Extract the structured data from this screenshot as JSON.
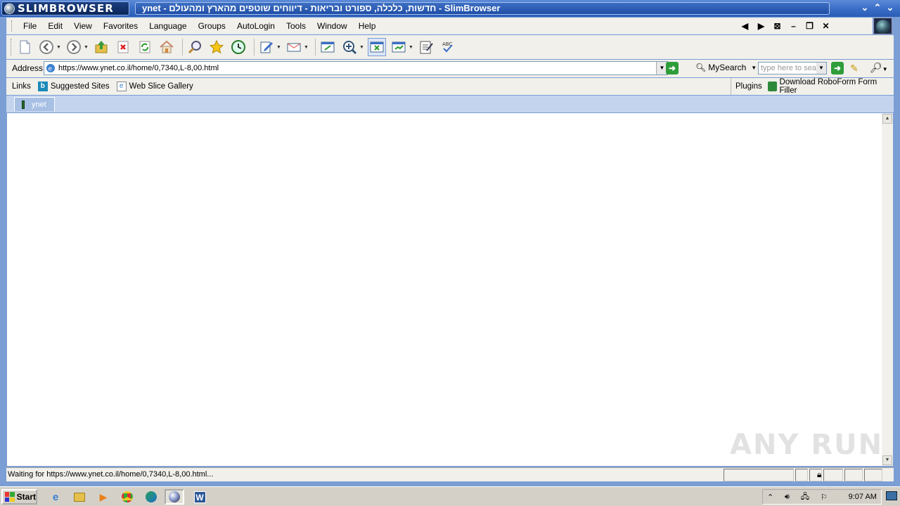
{
  "window": {
    "brand": "SLIMBROWSER",
    "title": "ynet - חדשות, כלכלה, ספורט ובריאות - דיווחים שוטפים מהארץ ומהעולם - SlimBrowser"
  },
  "menu": [
    "File",
    "Edit",
    "View",
    "Favorites",
    "Language",
    "Groups",
    "AutoLogin",
    "Tools",
    "Window",
    "Help"
  ],
  "address": {
    "label": "Address",
    "url": "https://www.ynet.co.il/home/0,7340,L-8,00.html"
  },
  "search": {
    "label": "MySearch",
    "placeholder": "type here to sea"
  },
  "links": {
    "label": "Links",
    "items": [
      "Suggested Sites",
      "Web Slice Gallery"
    ]
  },
  "plugins": {
    "label": "Plugins",
    "roboform": "Download RoboForm Form Filler"
  },
  "tabs": [
    {
      "label": "ynet"
    }
  ],
  "status": {
    "text": "Waiting for https://www.ynet.co.il/home/0,7340,L-8,00.html..."
  },
  "watermark": "ANY RUN",
  "taskbar": {
    "start": "Start",
    "clock": "9:07 AM"
  },
  "colors": {
    "frame": "#7b9ed4",
    "titlebar": "#3b6ec6",
    "toolbar": "#f1f0eb"
  }
}
